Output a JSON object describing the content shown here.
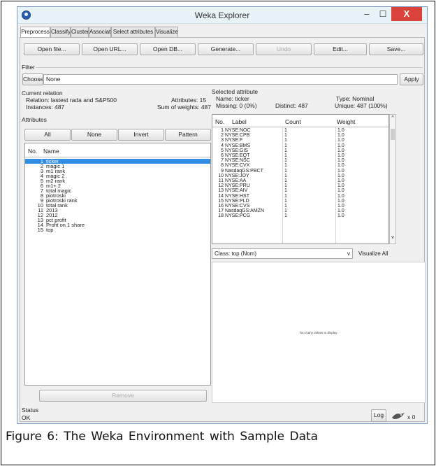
{
  "window": {
    "title": "Weka Explorer",
    "minimize_glyph": "–",
    "maximize_glyph": "☐",
    "close_glyph": "X"
  },
  "tabs": [
    "Preprocess",
    "Classify",
    "Cluster",
    "Associate",
    "Select attributes",
    "Visualize"
  ],
  "toolbar": {
    "open_file": "Open file...",
    "open_url": "Open URL...",
    "open_db": "Open DB...",
    "generate": "Generate...",
    "undo": "Undo",
    "edit": "Edit...",
    "save": "Save..."
  },
  "filter": {
    "section_label": "Filter",
    "choose_label": "Choose",
    "value": "None",
    "apply_label": "Apply"
  },
  "current_relation": {
    "section_label": "Current relation",
    "relation": "Relation: lastest rada and S&P500",
    "instances": "Instances: 487",
    "attributes": "Attributes: 15",
    "sum_weights": "Sum of weights: 487"
  },
  "attributes_panel": {
    "section_label": "Attributes",
    "all": "All",
    "none": "None",
    "invert": "Invert",
    "pattern": "Pattern",
    "col_no": "No.",
    "col_name": "Name",
    "items": [
      {
        "no": "1",
        "name": "ticker"
      },
      {
        "no": "2",
        "name": "magic 1"
      },
      {
        "no": "3",
        "name": "m1 rank"
      },
      {
        "no": "4",
        "name": "magic 2"
      },
      {
        "no": "5",
        "name": "m2 rank"
      },
      {
        "no": "6",
        "name": "m1+ 2"
      },
      {
        "no": "7",
        "name": "total magic"
      },
      {
        "no": "8",
        "name": "piotroski"
      },
      {
        "no": "9",
        "name": "piotroski rank"
      },
      {
        "no": "10",
        "name": "total rank"
      },
      {
        "no": "11",
        "name": "2013"
      },
      {
        "no": "12",
        "name": "2012"
      },
      {
        "no": "13",
        "name": "pct profit"
      },
      {
        "no": "14",
        "name": "Profit on 1 share"
      },
      {
        "no": "15",
        "name": "top"
      }
    ],
    "remove_label": "Remove"
  },
  "selected_attribute": {
    "section_label": "Selected attribute",
    "name": "Name: ticker",
    "type": "Type: Nominal",
    "missing": "Missing: 0 (0%)",
    "distinct": "Distinct: 487",
    "unique": "Unique: 487 (100%)",
    "col_no": "No.",
    "col_label": "Label",
    "col_count": "Count",
    "col_weight": "Weight",
    "rows": [
      {
        "no": "1",
        "label": "NYSE:NOC",
        "count": "1",
        "weight": "1.0"
      },
      {
        "no": "2",
        "label": "NYSE:CPB",
        "count": "1",
        "weight": "1.0"
      },
      {
        "no": "3",
        "label": "NYSE:F",
        "count": "1",
        "weight": "1.0"
      },
      {
        "no": "4",
        "label": "NYSE:BMS",
        "count": "1",
        "weight": "1.0"
      },
      {
        "no": "5",
        "label": "NYSE:GIS",
        "count": "1",
        "weight": "1.0"
      },
      {
        "no": "6",
        "label": "NYSE:EQT",
        "count": "1",
        "weight": "1.0"
      },
      {
        "no": "7",
        "label": "NYSE:NSC",
        "count": "1",
        "weight": "1.0"
      },
      {
        "no": "8",
        "label": "NYSE:CVX",
        "count": "1",
        "weight": "1.0"
      },
      {
        "no": "9",
        "label": "NasdaqGS:PBCT",
        "count": "1",
        "weight": "1.0"
      },
      {
        "no": "10",
        "label": "NYSE:JOY",
        "count": "1",
        "weight": "1.0"
      },
      {
        "no": "11",
        "label": "NYSE:AA",
        "count": "1",
        "weight": "1.0"
      },
      {
        "no": "12",
        "label": "NYSE:PRU",
        "count": "1",
        "weight": "1.0"
      },
      {
        "no": "13",
        "label": "NYSE:AIV",
        "count": "1",
        "weight": "1.0"
      },
      {
        "no": "14",
        "label": "NYSE:HST",
        "count": "1",
        "weight": "1.0"
      },
      {
        "no": "15",
        "label": "NYSE:PLD",
        "count": "1",
        "weight": "1.0"
      },
      {
        "no": "16",
        "label": "NYSE:CVS",
        "count": "1",
        "weight": "1.0"
      },
      {
        "no": "17",
        "label": "NasdaqGS:AMZN",
        "count": "1",
        "weight": "1.0"
      },
      {
        "no": "18",
        "label": "NYSE:PCG",
        "count": "1",
        "weight": "1.0"
      }
    ]
  },
  "class_select": {
    "value": "Class: top (Nom)",
    "visualize_all": "Visualize All"
  },
  "visualization": {
    "message": "Too many values to display."
  },
  "status": {
    "section_label": "Status",
    "text": "OK",
    "log_label": "Log",
    "task_count": "x 0"
  },
  "caption": "Figure 6: The Weka Environment with Sample Data",
  "colors": {
    "selection": "#2f8de4",
    "close_button": "#d9433b",
    "titlebar": "#e8f3f7"
  },
  "icons": [
    "weka-app-icon",
    "weka-bird-icon",
    "chevron-down-icon",
    "scroll-up-icon",
    "scroll-down-icon"
  ]
}
